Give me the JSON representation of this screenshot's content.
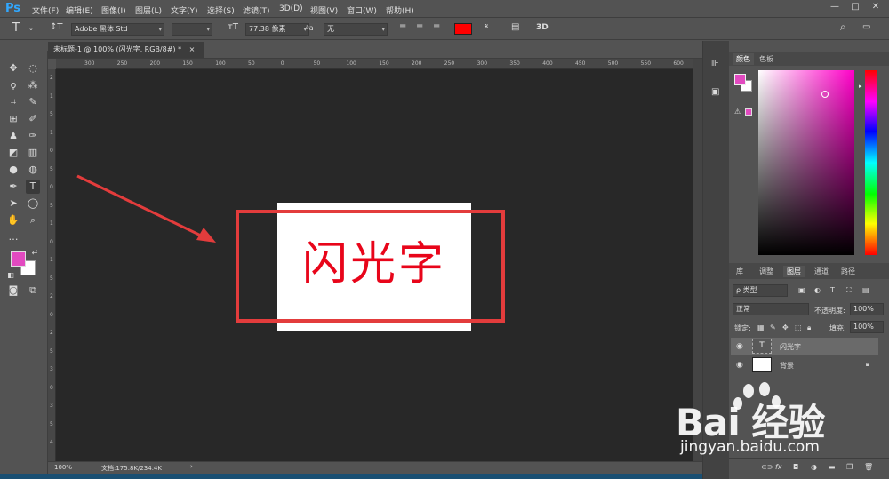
{
  "app": {
    "logo": "Ps"
  },
  "menubar": {
    "items": [
      "文件(F)",
      "编辑(E)",
      "图像(I)",
      "图层(L)",
      "文字(Y)",
      "选择(S)",
      "滤镜(T)",
      "3D(D)",
      "视图(V)",
      "窗口(W)",
      "帮助(H)"
    ]
  },
  "options": {
    "font_family": "Adobe 黑体 Std",
    "font_size": "77.38 像素",
    "aa_label": "ªa",
    "anti_alias": "无",
    "text_color": "#ff0000",
    "threed": "3D"
  },
  "document": {
    "tab_title": "未标题-1 @ 100% (闪光字, RGB/8#) *",
    "canvas_text": "闪光字",
    "canvas_text_color": "#e8051a",
    "zoom": "100%",
    "doc_info": "文档:175.8K/234.4K",
    "ruler_top": [
      "300",
      "250",
      "200",
      "150",
      "100",
      "50",
      "0",
      "50",
      "100",
      "150",
      "200",
      "250",
      "300",
      "350",
      "400",
      "450",
      "500",
      "550",
      "600"
    ],
    "ruler_left": [
      "2",
      "1",
      "5",
      "1",
      "0",
      "5",
      "0",
      "5",
      "1",
      "0",
      "1",
      "5",
      "2",
      "0",
      "2",
      "5",
      "3",
      "0",
      "3",
      "5",
      "4"
    ]
  },
  "colors": {
    "foreground": "#e24ac0",
    "background": "#ffffff",
    "accent_annotation": "#e33c3c"
  },
  "color_panel": {
    "tabs": [
      "颜色",
      "色板"
    ]
  },
  "layers_panel": {
    "tabs": [
      "库",
      "调整",
      "图层",
      "通道",
      "路径"
    ],
    "filter": "ρ 类型",
    "blend_mode": "正常",
    "opacity_label": "不透明度:",
    "opacity": "100%",
    "lock_label": "锁定:",
    "fill_label": "填充:",
    "fill": "100%",
    "layers": [
      {
        "name": "闪光字",
        "type": "text",
        "thumb": "T"
      },
      {
        "name": "背景",
        "type": "background"
      }
    ],
    "bottom_icons": [
      "link-icon",
      "fx-icon",
      "mask-icon",
      "adjustment-icon",
      "folder-icon",
      "new-layer-icon",
      "trash-icon"
    ]
  },
  "watermark": {
    "brand": "Bai 经验",
    "url": "jingyan.baidu.com"
  },
  "window_controls": [
    "—",
    "□",
    "✕"
  ]
}
